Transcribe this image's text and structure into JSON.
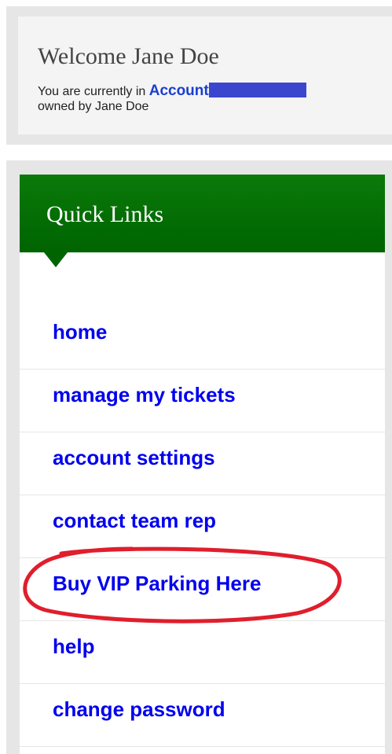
{
  "welcome": {
    "title": "Welcome Jane Doe",
    "line1_prefix": "You are currently in ",
    "account_link": "Account",
    "line2": "owned by Jane Doe"
  },
  "quick_links": {
    "title": "Quick Links",
    "items": [
      {
        "label": "home"
      },
      {
        "label": "manage my tickets"
      },
      {
        "label": "account settings"
      },
      {
        "label": "contact team rep"
      },
      {
        "label": "Buy VIP Parking Here",
        "highlighted": true
      },
      {
        "label": "help"
      },
      {
        "label": "change password"
      }
    ]
  },
  "colors": {
    "header_green": "#006400",
    "link_blue": "#0000ee",
    "account_blue": "#1a3fd0",
    "highlight_red": "#e01e2c"
  }
}
